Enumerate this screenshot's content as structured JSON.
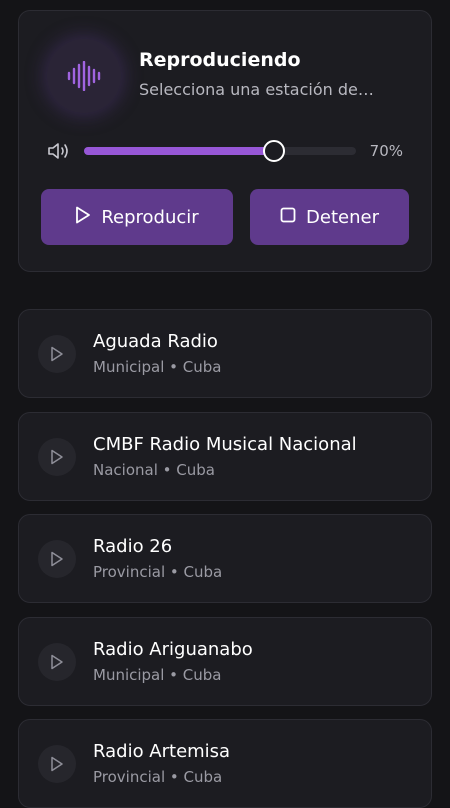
{
  "player": {
    "title": "Reproduciendo",
    "subtitle": "Selecciona una estación de…",
    "volume": 0.7,
    "volume_label": "70%",
    "play_label": "Reproducir",
    "stop_label": "Detener",
    "icons": {
      "visualizer": "sound-wave-icon",
      "volume": "speaker-icon",
      "play": "play-icon",
      "stop": "stop-icon"
    }
  },
  "colors": {
    "accent": "#9757d7",
    "button": "#5f3a8c",
    "background": "#141417",
    "card": "#1c1c21"
  },
  "stations": [
    {
      "name": "Aguada Radio",
      "meta": "Municipal • Cuba"
    },
    {
      "name": "CMBF Radio Musical Nacional",
      "meta": "Nacional • Cuba"
    },
    {
      "name": "Radio 26",
      "meta": "Provincial • Cuba"
    },
    {
      "name": "Radio Ariguanabo",
      "meta": "Municipal • Cuba"
    },
    {
      "name": "Radio Artemisa",
      "meta": "Provincial • Cuba"
    }
  ]
}
